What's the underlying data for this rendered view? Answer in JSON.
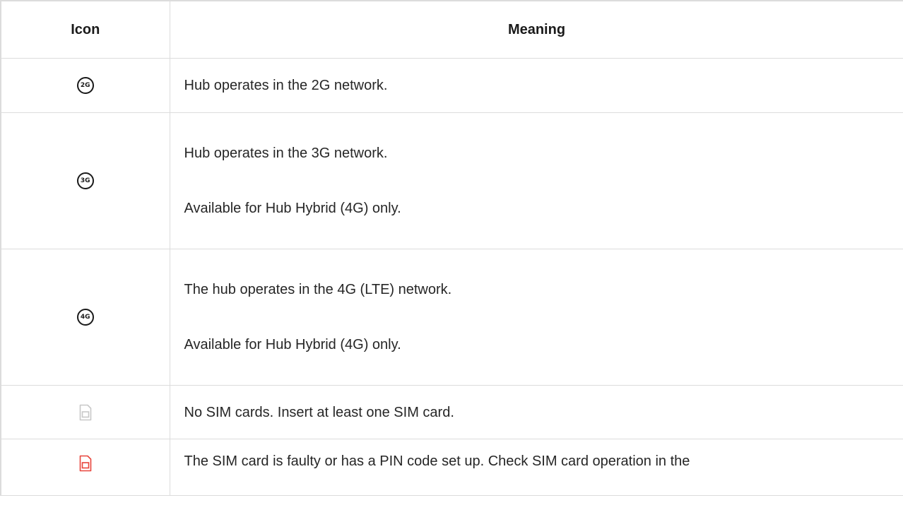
{
  "table": {
    "headers": {
      "icon": "Icon",
      "meaning": "Meaning"
    },
    "rows": [
      {
        "icon_name": "2g-network-icon",
        "icon_text": "2G",
        "lines": [
          "Hub operates in the 2G network."
        ]
      },
      {
        "icon_name": "3g-network-icon",
        "icon_text": "3G",
        "lines": [
          "Hub operates in the 3G network.",
          "Available for Hub Hybrid (4G) only."
        ]
      },
      {
        "icon_name": "4g-network-icon",
        "icon_text": "4G",
        "lines": [
          "The hub operates in the 4G (LTE) network.",
          "Available for Hub Hybrid (4G) only."
        ]
      },
      {
        "icon_name": "no-sim-icon",
        "icon_color": "#c8c8c8",
        "lines": [
          "No SIM cards. Insert at least one SIM card."
        ]
      },
      {
        "icon_name": "faulty-sim-icon",
        "icon_color": "#e8453c",
        "lines": [
          "The SIM card is faulty or has a PIN code set up. Check SIM card operation in the"
        ]
      }
    ]
  }
}
